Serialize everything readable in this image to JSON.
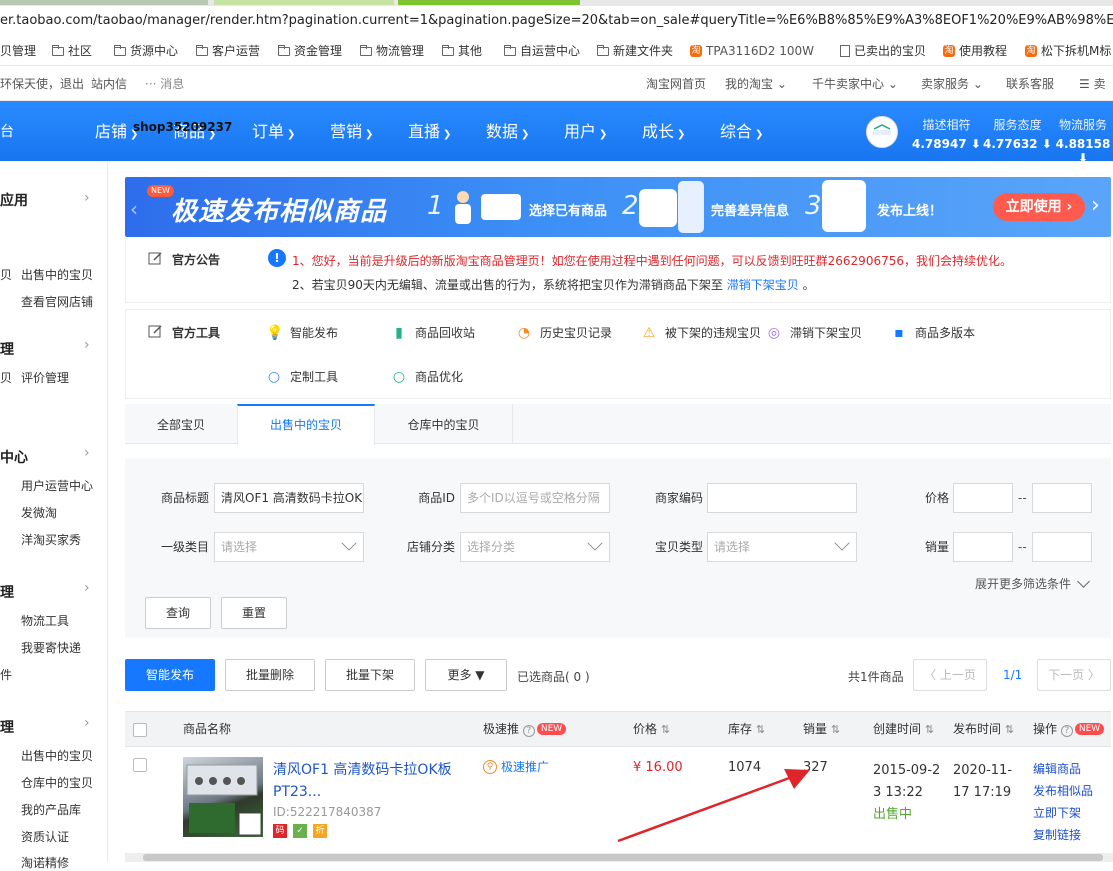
{
  "browser": {
    "url": "er.taobao.com/taobao/manager/render.htm?pagination.current=1&pagination.pageSize=20&tab=on_sale#queryTitle=%E6%B8%85%E9%A3%8EOF1%20%E9%AB%98%E6%B8%85%E6%95%B0%",
    "bookmarks": [
      "贝管理",
      "社区",
      "货源中心",
      "客户运营",
      "资金管理",
      "物流管理",
      "其他",
      "自运营中心",
      "新建文件夹",
      "TPA3116D2 100W",
      "已卖出的宝贝",
      "使用教程",
      "松下拆机M标"
    ]
  },
  "sitebar": {
    "left": "环保天使，退出",
    "inbox": "站内信",
    "messages": "··· 消息",
    "links": [
      "淘宝网首页",
      "我的淘宝 ⌄",
      "千牛卖家中心 ⌄",
      "卖家服务 ⌄",
      "联系客服",
      "☰ 卖家"
    ]
  },
  "nav": {
    "brand": "台",
    "items": [
      "店铺",
      "商品",
      "订单",
      "营销",
      "直播",
      "数据",
      "用户",
      "成长",
      "综合"
    ],
    "shop_name": "shop35209237",
    "scores": [
      {
        "label": "描述相符",
        "value": "4.78947 ⬇"
      },
      {
        "label": "服务态度",
        "value": "4.77632 ⬇"
      },
      {
        "label": "物流服务",
        "value": "4.88158 ⬇"
      }
    ]
  },
  "sidebar": {
    "sections": [
      {
        "title": "应用",
        "items": [
          "出售中的宝贝",
          "查看官网店铺"
        ],
        "stubs": [
          "贝"
        ]
      },
      {
        "title": "理",
        "items": [
          "评价管理"
        ],
        "stubs": [
          "贝"
        ]
      },
      {
        "title": "中心",
        "items": [
          "用户运营中心",
          "发微淘",
          "洋淘买家秀"
        ],
        "stubs": []
      },
      {
        "title": "理",
        "items": [
          "物流工具",
          "我要寄快递"
        ],
        "stubs": [
          "件"
        ]
      },
      {
        "title": "理",
        "items": [
          "出售中的宝贝",
          "仓库中的宝贝",
          "我的产品库",
          "资质认证",
          "淘诺精修"
        ],
        "stubs": []
      }
    ]
  },
  "banner": {
    "badge": "NEW",
    "title": "极速发布相似商品",
    "steps": [
      {
        "num": "1",
        "text": "选择已有商品"
      },
      {
        "num": "2",
        "text": "完善差异信息"
      },
      {
        "num": "3",
        "text": "发布上线！"
      }
    ],
    "cta": "立即使用 ›"
  },
  "notice": {
    "label": "官方公告",
    "line1": "1、您好，当前是升级后的新版淘宝商品管理页！如您在使用过程中遇到任何问题，可以反馈到旺旺群2662906756，我们会持续优化。",
    "line2_prefix": "2、若宝贝90天内无编辑、流量或出售的行为，系统将把宝贝作为滞销商品下架至",
    "line2_link": "滞销下架宝贝",
    "line2_suffix": "。"
  },
  "tools": {
    "label": "官方工具",
    "items": [
      "智能发布",
      "商品回收站",
      "历史宝贝记录",
      "被下架的违规宝贝",
      "滞销下架宝贝",
      "商品多版本",
      "定制工具",
      "商品优化"
    ]
  },
  "tabs": [
    "全部宝贝",
    "出售中的宝贝",
    "仓库中的宝贝"
  ],
  "filters": {
    "title_label": "商品标题",
    "title_value": "清风OF1 高清数码卡拉OK",
    "id_label": "商品ID",
    "id_placeholder": "多个ID以逗号或空格分隔",
    "code_label": "商家编码",
    "price_label": "价格",
    "range_sep": "--",
    "cat_label": "一级类目",
    "cat_placeholder": "请选择",
    "shopcat_label": "店铺分类",
    "shopcat_placeholder": "选择分类",
    "type_label": "宝贝类型",
    "type_placeholder": "请选择",
    "sales_label": "销量",
    "more": "展开更多筛选条件",
    "query": "查询",
    "reset": "重置"
  },
  "actions": {
    "publish": "智能发布",
    "batch_delete": "批量删除",
    "batch_off": "批量下架",
    "more": "更多 ▼",
    "selected": "已选商品( 0 )",
    "total": "共1件商品",
    "prev": "〈 上一页",
    "page": "1/1",
    "next": "下一页 〉"
  },
  "table": {
    "headers": [
      "商品名称",
      "极速推",
      "价格",
      "库存",
      "销量",
      "创建时间",
      "发布时间",
      "操作"
    ],
    "new_badge": "NEW",
    "rows": [
      {
        "title": "清风OF1 高清数码卡拉OK板 PT23...",
        "id": "ID:522217840387",
        "tags": [
          "码",
          "✓",
          "折"
        ],
        "promo": "极速推广",
        "price": "¥ 16.00",
        "stock": "1074",
        "sales": "327",
        "created": "2015-09-23 13:22",
        "status": "出售中",
        "published": "2020-11-17 17:19",
        "ops": [
          "编辑商品",
          "发布相似品",
          "立即下架",
          "复制链接"
        ]
      }
    ]
  },
  "colors": {
    "nav": "#1677ff",
    "accent": "#1677ff",
    "danger": "#e0252a",
    "price": "#e0252a",
    "status": "#52a82e"
  }
}
